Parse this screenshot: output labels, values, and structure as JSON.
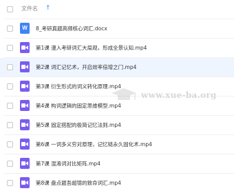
{
  "header": {
    "column_title": "文件名",
    "sort_indicator": "↑"
  },
  "files": [
    {
      "name": "8_考研真题高频核心词汇.docx",
      "type": "word",
      "icon_letter": "W"
    },
    {
      "name": "第1课 漫入考研词汇大局观，形成全景认知.mp4",
      "type": "video"
    },
    {
      "name": "第2课 词汇记忆术，开启效率倍增之门.mp4",
      "type": "video"
    },
    {
      "name": "第3课 衍生形式的词义转化原理.mp4",
      "type": "video"
    },
    {
      "name": "第4课 构词逻辑的固定思维模型.mp4",
      "type": "video"
    },
    {
      "name": "第5课 固定搭配的极简记忆法则.mp4",
      "type": "video"
    },
    {
      "name": "第6课 一词多义穷对原理，记忆链永久固化术.mp4",
      "type": "video"
    },
    {
      "name": "第7课 混淆词对比矩阵.mp4",
      "type": "video"
    },
    {
      "name": "第8课 盘点题吾超锦的致命词汇.mp4",
      "type": "video"
    }
  ],
  "watermark": "www.xue-ba.org",
  "colors": {
    "accent": "#3a8ef6",
    "word": "#3f83f7",
    "video": "#7a5cf0",
    "selected_row": "#eef5ff"
  }
}
